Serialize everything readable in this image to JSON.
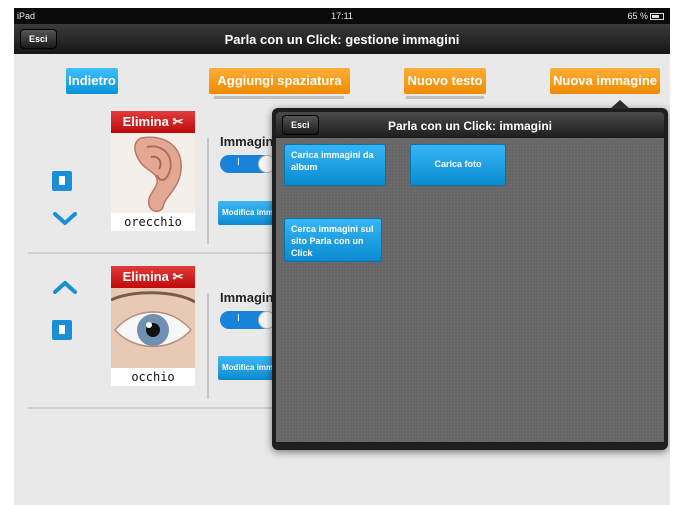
{
  "status_bar": {
    "device": "iPad",
    "time": "17:11",
    "battery": "65 %"
  },
  "navbar": {
    "exit_label": "Esci",
    "title": "Parla con un Click: gestione immagini"
  },
  "toolbar": {
    "back_label": "Indietro",
    "add_spacing_label": "Aggiungi spaziatura",
    "new_text_label": "Nuovo testo",
    "new_image_label": "Nuova immagine"
  },
  "rows": [
    {
      "delete_label": "Elimina",
      "caption": "orecchio",
      "image_label": "Immagin",
      "toggle_text": "I",
      "modify_label": "Modifica imm"
    },
    {
      "delete_label": "Elimina",
      "caption": "occhio",
      "image_label": "Immagin",
      "toggle_text": "I",
      "modify_label": "Modifica imm"
    }
  ],
  "popover": {
    "exit_label": "Esci",
    "title": "Parla con un Click: immagini",
    "load_album_label": "Carica immagini da album",
    "load_photo_label": "Carica foto",
    "search_site_label": "Cerca immagini sul sito Parla con un Click"
  },
  "colors": {
    "accent_blue": "#0a92d9",
    "accent_orange": "#f08a00",
    "delete_red": "#c00b0b"
  }
}
